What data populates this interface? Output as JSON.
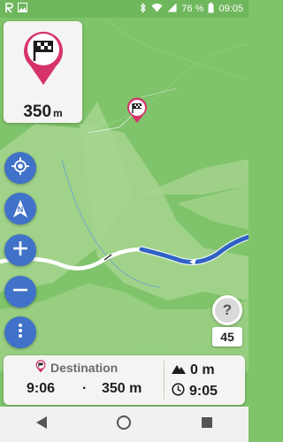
{
  "status_bar": {
    "battery_percent": "76 %",
    "time": "09:05"
  },
  "turn_card": {
    "distance_value": "350",
    "distance_unit": "m"
  },
  "map_controls": {
    "icons": [
      "locate-icon",
      "compass-north-icon",
      "zoom-in-icon",
      "zoom-out-icon",
      "more-options-icon"
    ],
    "compass_letter": "N"
  },
  "speed_sign": {
    "sign_text": "?",
    "current_speed": "45"
  },
  "info_panel": {
    "destination_label": "Destination",
    "arrival_time": "9:06",
    "separator": "·",
    "remaining_distance": "350 m",
    "ascent": "0 m",
    "clock_time": "9:05"
  },
  "colors": {
    "map_green": "#7fc36a",
    "route_blue": "#2f62c4",
    "button_blue": "#3f72c8",
    "pin_pink": "#d6336c"
  }
}
